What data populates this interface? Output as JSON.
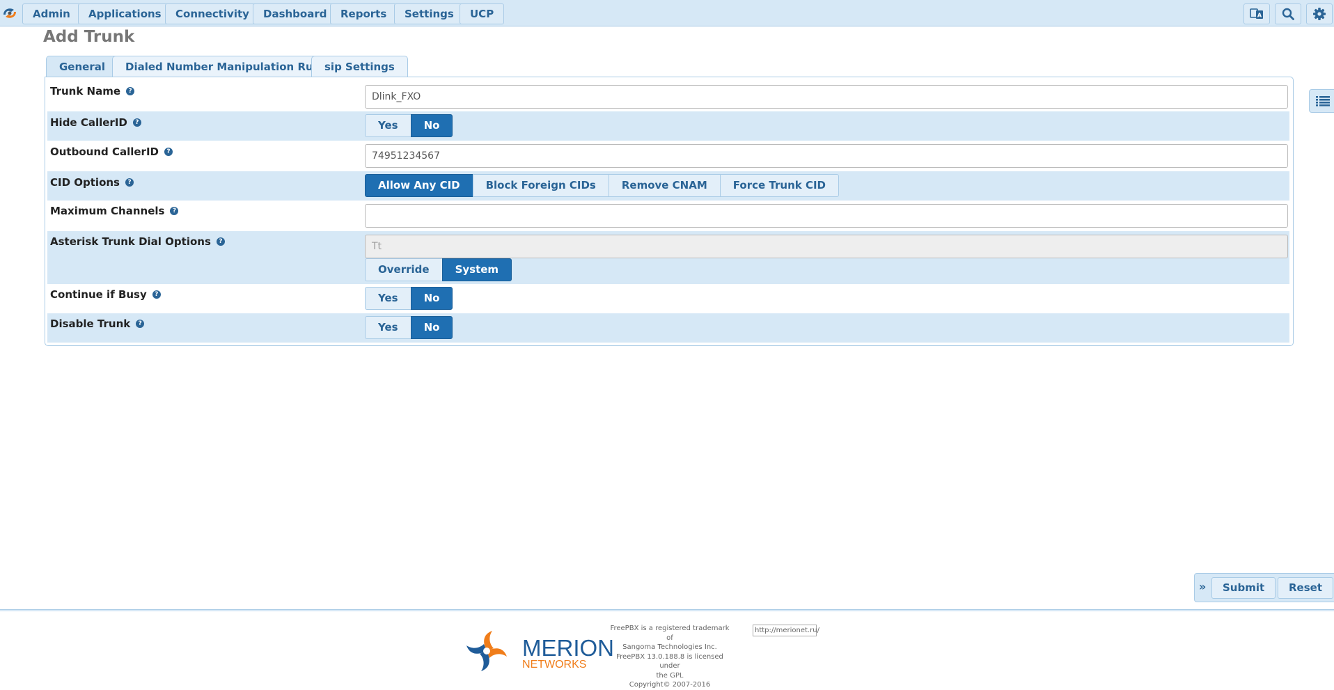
{
  "nav": {
    "items": [
      {
        "label": "Admin"
      },
      {
        "label": "Applications"
      },
      {
        "label": "Connectivity"
      },
      {
        "label": "Dashboard"
      },
      {
        "label": "Reports"
      },
      {
        "label": "Settings"
      },
      {
        "label": "UCP"
      }
    ],
    "icons": [
      "translate-icon",
      "search-icon",
      "gear-icon"
    ]
  },
  "page": {
    "title": "Add Trunk"
  },
  "tabs": [
    {
      "label": "General",
      "active": true
    },
    {
      "label": "Dialed Number Manipulation Rules",
      "active": false
    },
    {
      "label": "sip Settings",
      "active": false
    }
  ],
  "form": {
    "trunk_name": {
      "label": "Trunk Name",
      "value": "Dlink_FXO"
    },
    "hide_callerid": {
      "label": "Hide CallerID",
      "options": [
        "Yes",
        "No"
      ],
      "selected": "No"
    },
    "outbound_callerid": {
      "label": "Outbound CallerID",
      "value": "74951234567"
    },
    "cid_options": {
      "label": "CID Options",
      "options": [
        "Allow Any CID",
        "Block Foreign CIDs",
        "Remove CNAM",
        "Force Trunk CID"
      ],
      "selected": "Allow Any CID"
    },
    "max_channels": {
      "label": "Maximum Channels",
      "value": ""
    },
    "dial_options": {
      "label": "Asterisk Trunk Dial Options",
      "value": "Tt",
      "options": [
        "Override",
        "System"
      ],
      "selected": "System"
    },
    "continue_busy": {
      "label": "Continue if Busy",
      "options": [
        "Yes",
        "No"
      ],
      "selected": "No"
    },
    "disable_trunk": {
      "label": "Disable Trunk",
      "options": [
        "Yes",
        "No"
      ],
      "selected": "No"
    }
  },
  "actions": {
    "collapse": "»",
    "submit": "Submit",
    "reset": "Reset"
  },
  "footer": {
    "line1": "FreePBX is a registered trademark of",
    "line2": "Sangoma Technologies Inc.",
    "line3": "FreePBX 13.0.188.8 is licensed under",
    "line4": "the GPL",
    "line5": "Copyright© 2007-2016",
    "link": "http://merionet.ru/",
    "logo_main": "MERION",
    "logo_sub": "NETWORKS"
  },
  "colors": {
    "accent": "#1f6fb2",
    "nav_bg": "#d6e8f6",
    "link": "#2a6496",
    "logo_orange": "#f07d1a"
  }
}
